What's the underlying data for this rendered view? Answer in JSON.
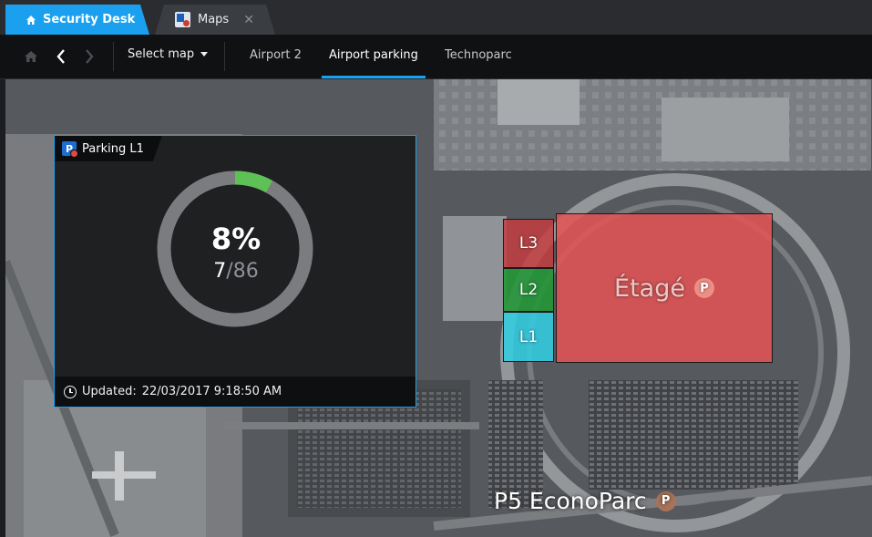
{
  "tabs": {
    "home_label": "Security Desk",
    "maps_label": "Maps",
    "close_glyph": "✕"
  },
  "toolbar": {
    "select_map_label": "Select map",
    "map_tabs": [
      {
        "label": "Airport 2"
      },
      {
        "label": "Airport parking"
      },
      {
        "label": "Technoparc"
      }
    ],
    "active_tab": "Airport parking"
  },
  "widget": {
    "title": "Parking L1",
    "percent_label": "8%",
    "occupied": "7",
    "separator": "/",
    "capacity": "86",
    "occupancy_fraction": 0.08,
    "updated_label": "Updated:",
    "updated_value": "22/03/2017 9:18:50 AM"
  },
  "map": {
    "zones": {
      "l3": "L3",
      "l2": "L2",
      "l1": "L1",
      "etage": "Étagé"
    },
    "pin_letter": "P",
    "econoparc_label": "P5 EconoParc"
  },
  "colors": {
    "accent": "#1aa0ee",
    "gauge_fill": "#5ec155",
    "gauge_track": "#7a7c80",
    "zone_l3": "#c63c3e",
    "zone_l2": "#229637",
    "zone_l1": "#32cde1",
    "zone_etage": "#e45454"
  }
}
